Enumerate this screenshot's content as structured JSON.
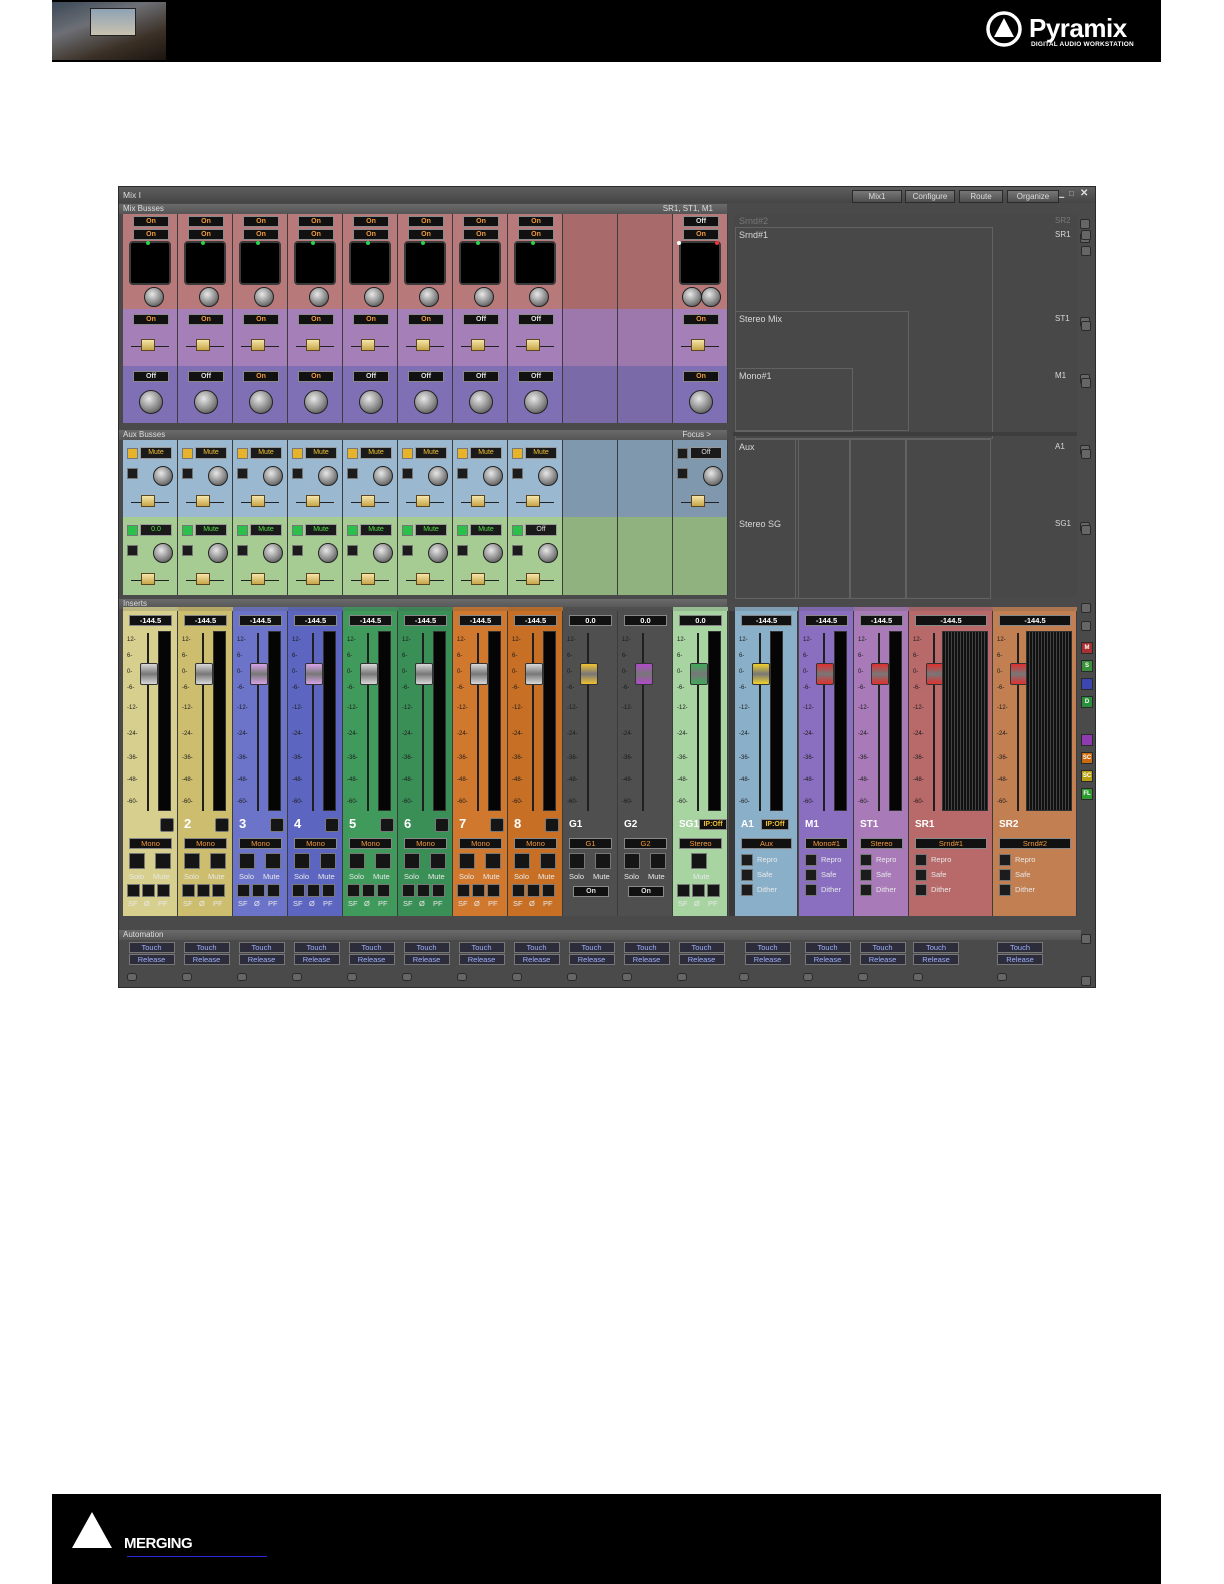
{
  "header": {
    "product_name": "Pyramix",
    "product_tagline": "DIGITAL AUDIO WORKSTATION"
  },
  "footer": {
    "company_name": "MERGING"
  },
  "window": {
    "title": "Mix I",
    "toolbar": [
      "Mix1",
      "Configure",
      "Route",
      "Organize"
    ],
    "controls": [
      "minimize-icon",
      "maximize-icon",
      "close-icon"
    ]
  },
  "sections": {
    "mix_busses": "Mix Busses",
    "mix_busses_right": "SR1, ST1, M1",
    "aux_busses": "Aux Busses",
    "aux_focus": "Focus >",
    "inserts": "Inserts",
    "automation": "Automation"
  },
  "mix_busses": {
    "row1": [
      "On",
      "On",
      "On",
      "On",
      "On",
      "On",
      "On",
      "On",
      "Off"
    ],
    "row2": [
      "On",
      "On",
      "On",
      "On",
      "On",
      "On",
      "On",
      "On",
      "On"
    ],
    "row3": [
      "On",
      "On",
      "On",
      "On",
      "On",
      "On",
      "Off",
      "Off",
      "On"
    ],
    "row4": [
      "Off",
      "Off",
      "On",
      "On",
      "Off",
      "Off",
      "Off",
      "Off",
      "On"
    ]
  },
  "aux_busses": {
    "row1": [
      "Mute",
      "Mute",
      "Mute",
      "Mute",
      "Mute",
      "Mute",
      "Mute",
      "Mute",
      "Off"
    ],
    "row2": [
      "0.0",
      "Mute",
      "Mute",
      "Mute",
      "Mute",
      "Mute",
      "Mute",
      "Off"
    ]
  },
  "bus_tree": {
    "labels": [
      "Srnd#2",
      "Srnd#1",
      "Stereo Mix",
      "Mono#1",
      "Aux",
      "Stereo SG"
    ],
    "codes": [
      "SR2",
      "SR1",
      "ST1",
      "M1",
      "A1",
      "SG1"
    ]
  },
  "channels": [
    {
      "id": "ch1",
      "num": "",
      "value": "-144.5",
      "type": "Mono",
      "color": "#d7cf8e"
    },
    {
      "id": "ch2",
      "num": "2",
      "value": "-144.5",
      "type": "Mono",
      "color": "#cdbd6e"
    },
    {
      "id": "ch3",
      "num": "3",
      "value": "-144.5",
      "type": "Mono",
      "color": "#6b74c9"
    },
    {
      "id": "ch4",
      "num": "4",
      "value": "-144.5",
      "type": "Mono",
      "color": "#5c66c0"
    },
    {
      "id": "ch5",
      "num": "5",
      "value": "-144.5",
      "type": "Mono",
      "color": "#3f9a5c"
    },
    {
      "id": "ch6",
      "num": "6",
      "value": "-144.5",
      "type": "Mono",
      "color": "#3a8f56"
    },
    {
      "id": "ch7",
      "num": "7",
      "value": "-144.5",
      "type": "Mono",
      "color": "#d0782e"
    },
    {
      "id": "ch8",
      "num": "8",
      "value": "-144.5",
      "type": "Mono",
      "color": "#c77025"
    },
    {
      "id": "g1",
      "num": "G1",
      "value": "0.0",
      "type": "G1",
      "color": "#4f4f4f"
    },
    {
      "id": "g2",
      "num": "G2",
      "value": "0.0",
      "type": "G2",
      "color": "#4f4f4f"
    },
    {
      "id": "sg1",
      "num": "SG1",
      "value": "0.0",
      "type": "Stereo",
      "color": "#a8d4a2",
      "ip": "IP:Off"
    }
  ],
  "channel_buttons": {
    "solo": "Solo",
    "mute": "Mute",
    "sf": "SF",
    "phase": "Ø",
    "pf": "PF",
    "on": "On"
  },
  "masters": [
    {
      "id": "a1",
      "num": "A1",
      "value": "-144.5",
      "type": "Aux",
      "color": "#8ab0c9",
      "ip": "IP:Off"
    },
    {
      "id": "m1",
      "num": "M1",
      "value": "-144.5",
      "type": "Mono#1",
      "color": "#8a6fc0"
    },
    {
      "id": "st1",
      "num": "ST1",
      "value": "-144.5",
      "type": "Stereo",
      "color": "#a87ab8"
    },
    {
      "id": "sr1",
      "num": "SR1",
      "value": "-144.5",
      "type": "Srnd#1",
      "color": "#b86a6a"
    },
    {
      "id": "sr2",
      "num": "SR2",
      "value": "-144.5",
      "type": "Srnd#2",
      "color": "#c27f52"
    }
  ],
  "master_buttons": {
    "repro": "Repro",
    "safe": "Safe",
    "dither": "Dither"
  },
  "scale": [
    "12-",
    "6-",
    "0-",
    "-6-",
    "-12-",
    "-24-",
    "-36-",
    "-48-",
    "-60-"
  ],
  "automation": {
    "touch": "Touch",
    "release": "Release"
  },
  "side_buttons": [
    "M",
    "S",
    "",
    "D",
    "",
    "SC",
    "SC",
    "FL"
  ]
}
